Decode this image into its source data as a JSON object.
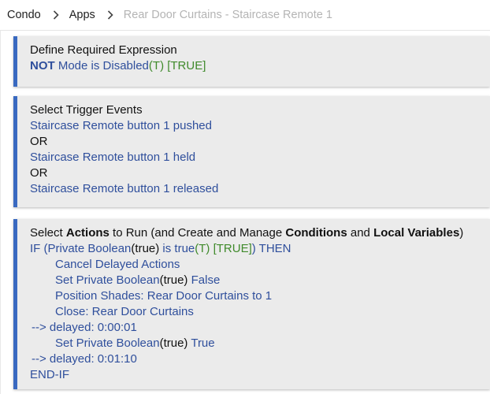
{
  "breadcrumb": {
    "items": [
      "Condo",
      "Apps",
      "Rear Door Curtains - Staircase Remote 1"
    ]
  },
  "required_expression": {
    "title": "Define Required Expression",
    "not": "NOT",
    "condition": "Mode is Disabled",
    "state": "(T) [TRUE]"
  },
  "triggers": {
    "title": "Select Trigger Events",
    "events": [
      "Staircase Remote button 1 pushed",
      "Staircase Remote button 1 held",
      "Staircase Remote button 1 released"
    ],
    "or": "OR"
  },
  "actions": {
    "title_parts": [
      "Select ",
      "Actions",
      " to Run (and Create and Manage ",
      "Conditions",
      " and ",
      "Local Variables",
      ")"
    ],
    "if_prefix": "IF (Private Boolean",
    "if_paren": "(true)",
    "if_is": " is true",
    "if_state": "(T) [TRUE]",
    "if_then": ") THEN",
    "cancel": "Cancel Delayed Actions",
    "set1_prefix": "Set Private Boolean",
    "set1_paren": "(true)",
    "set1_value": " False",
    "position": "Position Shades: Rear Door Curtains to 1",
    "close": "Close: Rear Door Curtains",
    "delay1": "--> delayed: 0:00:01",
    "set2_prefix": "Set Private Boolean",
    "set2_paren": "(true)",
    "set2_value": " True",
    "delay2": "--> delayed: 0:01:10",
    "end_if": "END-IF"
  },
  "colors": {
    "accent": "#3969c0",
    "link_text": "#2f4f9c",
    "state_green": "#3f8a2b",
    "panel_bg": "#ebebeb"
  }
}
